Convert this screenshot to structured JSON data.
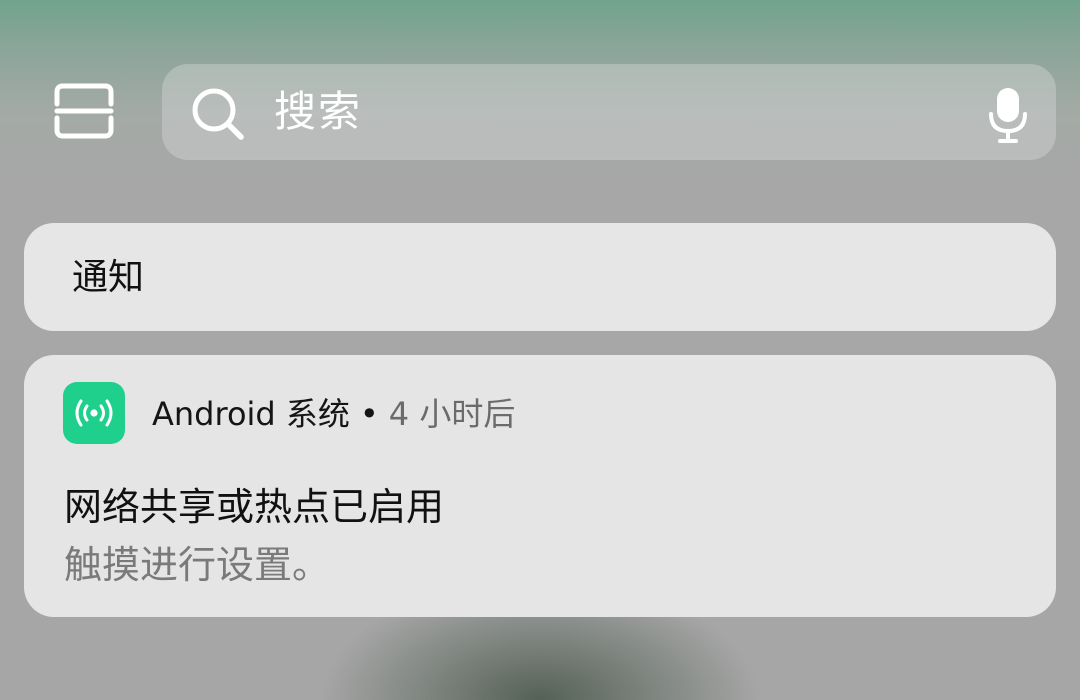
{
  "search": {
    "placeholder": "搜索",
    "left_icon": "search-icon",
    "right_icon": "mic-icon"
  },
  "toolbar": {
    "scan_icon": "scan-icon"
  },
  "notifications_header": {
    "title": "通知"
  },
  "notification": {
    "app_icon": "hotspot-icon",
    "app_name": "Android 系统",
    "separator": "•",
    "time": "4 小时后",
    "title": "网络共享或热点已启用",
    "text": "触摸进行设置。"
  },
  "colors": {
    "app_icon_bg": "#1fd08c",
    "card_bg": "#e5e5e5",
    "top_tint": "#71a48d"
  }
}
